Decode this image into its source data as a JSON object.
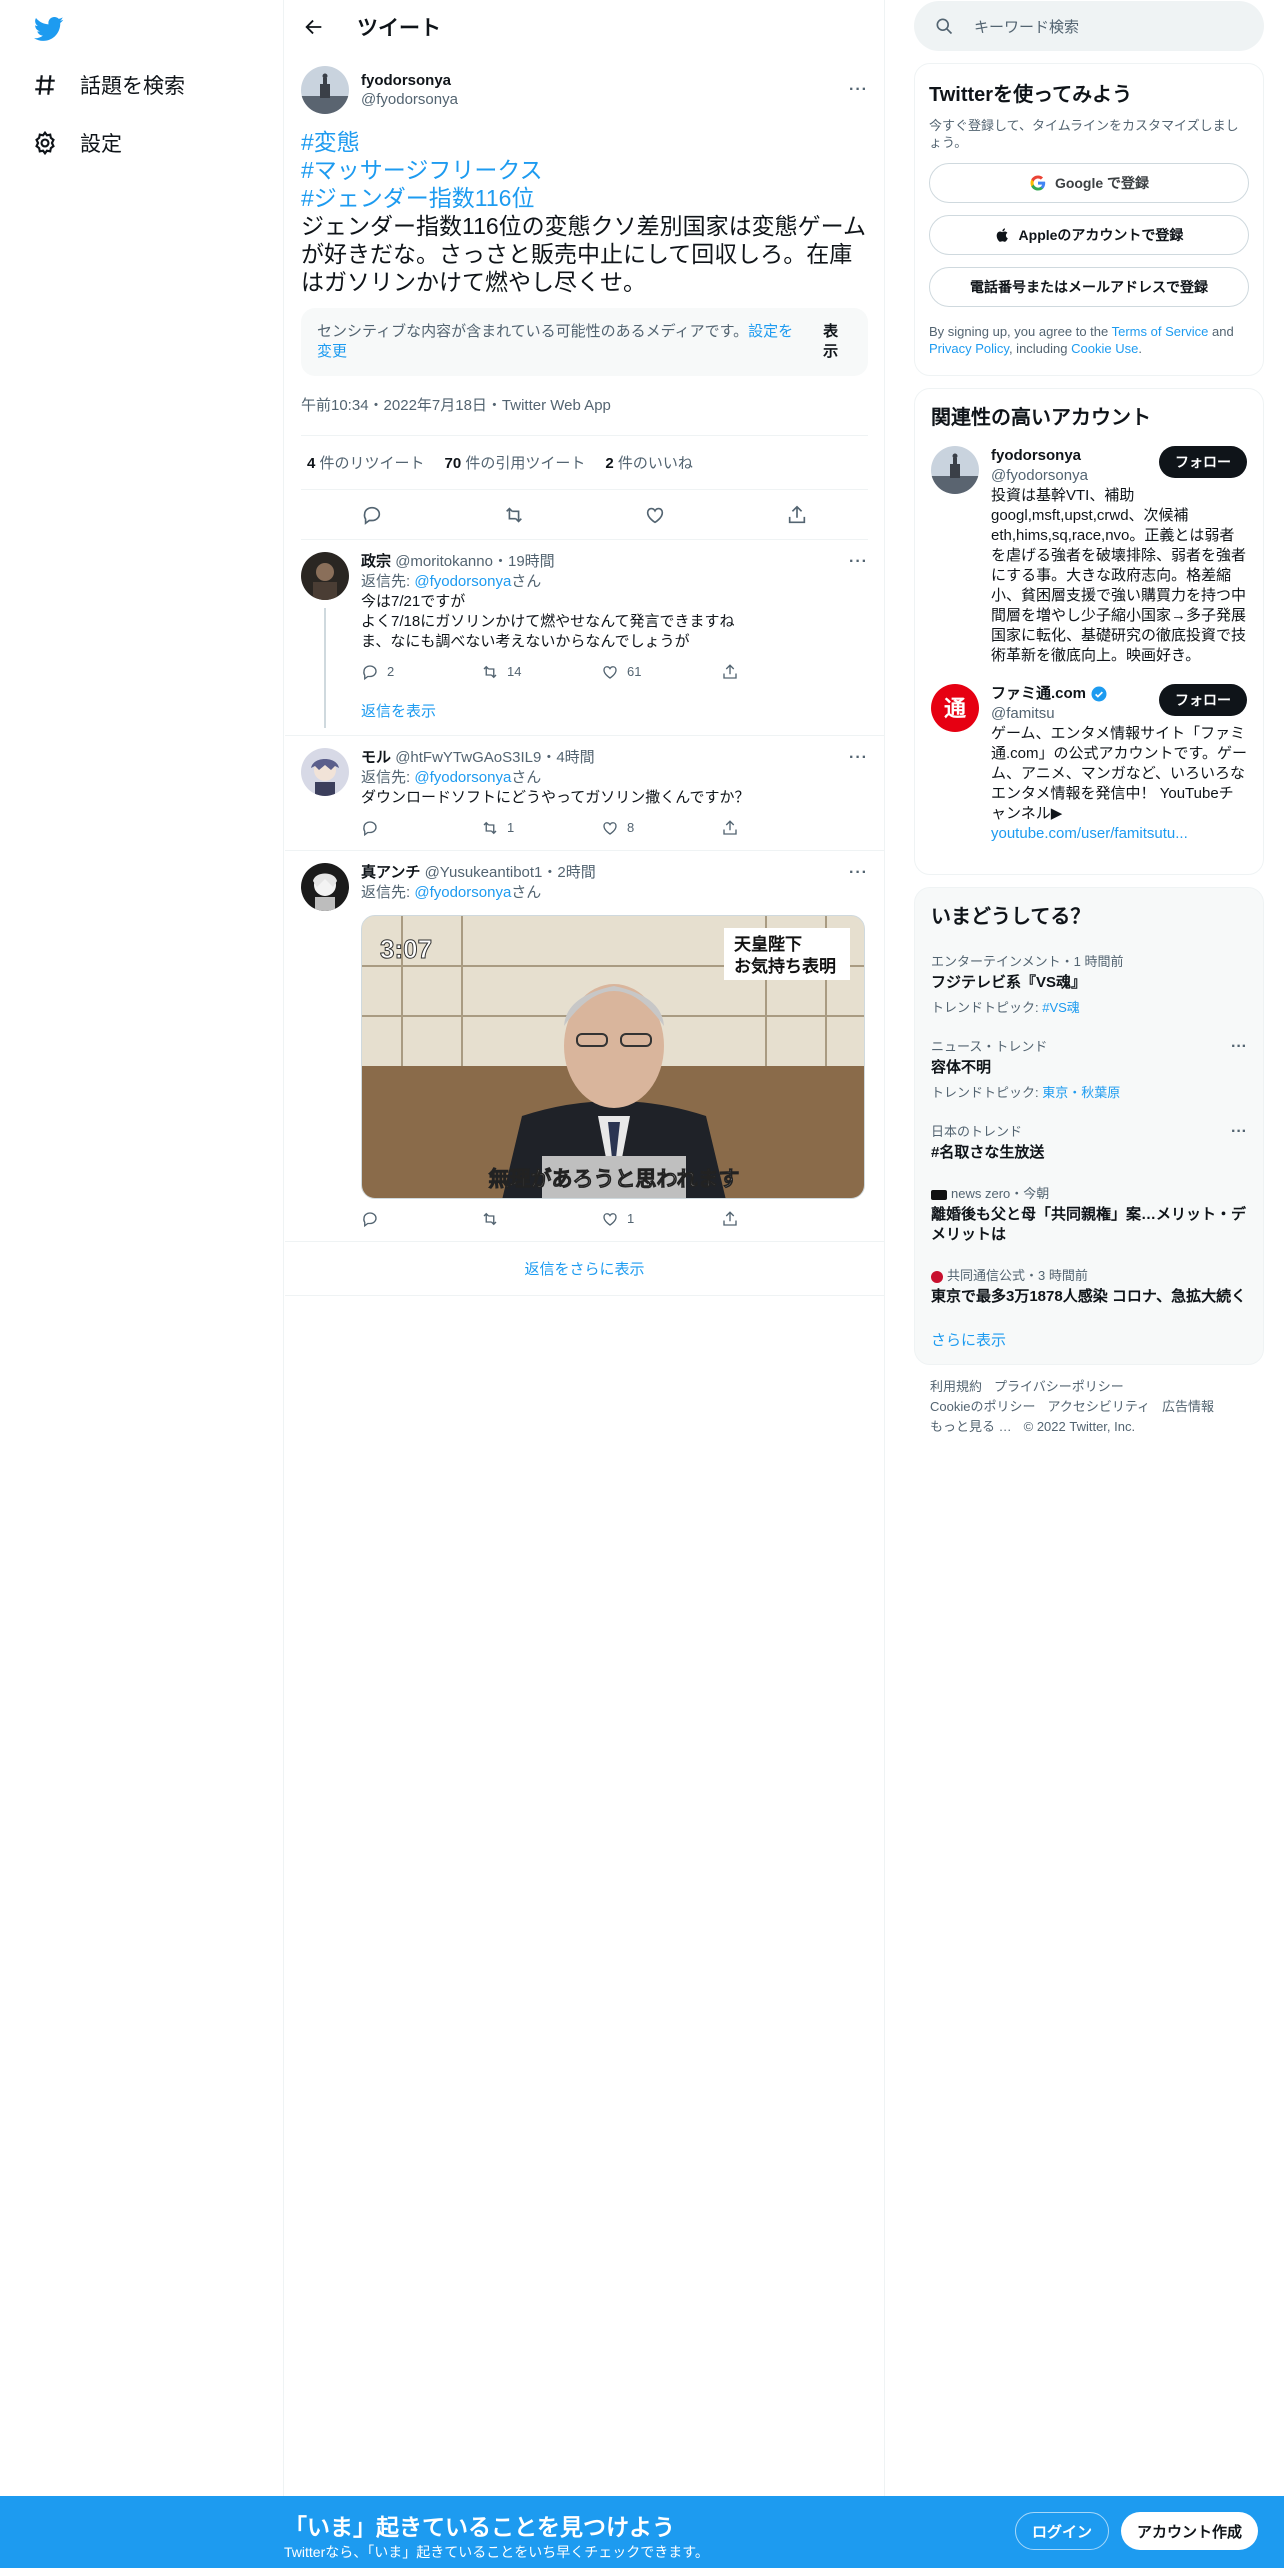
{
  "nav": {
    "explore_label": "話題を検索",
    "settings_label": "設定"
  },
  "header": {
    "title": "ツイート"
  },
  "tweet": {
    "name": "fyodorsonya",
    "handle": "@fyodorsonya",
    "hashtags": [
      "#変態",
      "#マッサージフリークス",
      "#ジェンダー指数116位"
    ],
    "text": "ジェンダー指数116位の変態クソ差別国家は変態ゲームが好きだな。さっさと販売中止にして回収しろ。在庫はガソリンかけて燃やし尽くせ。",
    "sensitive_notice": "センシティブな内容が含まれている可能性のあるメディアです。",
    "sensitive_link": "設定を変更",
    "show_label": "表示",
    "meta": "午前10:34・2022年7月18日・Twitter Web App",
    "stats": {
      "retweets_count": "4",
      "retweets_label": "件のリツイート",
      "quotes_count": "70",
      "quotes_label": "件の引用ツイート",
      "likes_count": "2",
      "likes_label": "件のいいね"
    }
  },
  "replies": [
    {
      "name": "政宗",
      "handle": "@moritokanno",
      "time": "19時間",
      "reply_to_prefix": "返信先: ",
      "reply_to": "@fyodorsonya",
      "reply_to_suffix": "さん",
      "lines": [
        "今は7/21ですが",
        "よく7/18にガソリンかけて燃やせなんて発言できますね",
        "ま、なにも調べない考えないからなんでしょうが"
      ],
      "replies_count": "2",
      "retweets_count": "14",
      "likes_count": "61",
      "show_replies": "返信を表示"
    },
    {
      "name": "モル",
      "handle": "@htFwYTwGAoS3IL9",
      "time": "4時間",
      "reply_to_prefix": "返信先: ",
      "reply_to": "@fyodorsonya",
      "reply_to_suffix": "さん",
      "lines": [
        "ダウンロードソフトにどうやってガソリン撒くんですか？"
      ],
      "replies_count": "",
      "retweets_count": "1",
      "likes_count": "8"
    },
    {
      "name": "真アンチ",
      "handle": "@Yusukeantibot1",
      "time": "2時間",
      "reply_to_prefix": "返信先: ",
      "reply_to": "@fyodorsonya",
      "reply_to_suffix": "さん",
      "media": {
        "clock": "3:07",
        "caption_top_1": "天皇陛下",
        "caption_top_2": "お気持ち表明",
        "subtitle": "無理があろうと思われます"
      },
      "replies_count": "",
      "retweets_count": "",
      "likes_count": "1"
    }
  ],
  "more_replies": "返信をさらに表示",
  "search": {
    "placeholder": "キーワード検索"
  },
  "signup": {
    "title": "Twitterを使ってみよう",
    "subtitle": "今すぐ登録して、タイムラインをカスタマイズしましょう。",
    "google": "Google で登録",
    "apple": "Appleのアカウントで登録",
    "phone": "電話番号またはメールアドレスで登録",
    "terms_prefix": "By signing up, you agree to the ",
    "terms_tos": "Terms of Service",
    "terms_and": " and ",
    "terms_privacy": "Privacy Policy",
    "terms_including": ", including ",
    "terms_cookie": "Cookie Use",
    "terms_end": "."
  },
  "who": {
    "title": "関連性の高いアカウント",
    "accounts": [
      {
        "name": "fyodorsonya",
        "handle": "@fyodorsonya",
        "follow": "フォロー",
        "bio": "投資は基幹VTI、補助googl,msft,upst,crwd、次候補eth,hims,sq,race,nvo。正義とは弱者を虐げる強者を破壊排除、弱者を強者にする事。大きな政府志向。格差縮小、貧困層支援で強い購買力を持つ中間層を増やし少子縮小国家→多子発展国家に転化、基礎研究の徹底投資で技術革新を徹底向上。映画好き。"
      },
      {
        "name": "ファミ通.com",
        "handle": "@famitsu",
        "follow": "フォロー",
        "bio": "ゲーム、エンタメ情報サイト「ファミ通.com」の公式アカウントです。ゲーム、アニメ、マンガなど、いろいろなエンタメ情報を発信中！ YouTubeチャンネル▶",
        "link": "youtube.com/user/famitsutu..."
      }
    ]
  },
  "trends": {
    "title": "いまどうしてる？",
    "items": [
      {
        "context": "エンターテインメント・1 時間前",
        "title": "フジテレビ系『VS魂』",
        "topic_prefix": "トレンドトピック: ",
        "topic": "#VS魂"
      },
      {
        "context": "ニュース・トレンド",
        "title": "容体不明",
        "topic_prefix": "トレンドトピック: ",
        "topic": "東京・秋葉原"
      },
      {
        "context": "日本のトレンド",
        "title": "#名取さな生放送"
      },
      {
        "context": "news zero・今朝",
        "title": "離婚後も父と母「共同親権」案…メリット・デメリットは"
      },
      {
        "context": "共同通信公式・3 時間前",
        "title": "東京で最多3万1878人感染 コロナ、急拡大続く"
      }
    ],
    "show_more": "さらに表示"
  },
  "footer": {
    "links": [
      "利用規約",
      "プライバシーポリシー",
      "Cookieのポリシー",
      "アクセシビリティ",
      "広告情報",
      "もっと見る …",
      "© 2022 Twitter, Inc."
    ]
  },
  "bottom": {
    "title": "「いま」起きていることを見つけよう",
    "subtitle": "Twitterなら、「いま」起きていることをいち早くチェックできます。",
    "login": "ログイン",
    "signup": "アカウント作成"
  },
  "colors": {
    "accent": "#1d9bf0",
    "text": "#0f1419",
    "muted": "#536471"
  }
}
